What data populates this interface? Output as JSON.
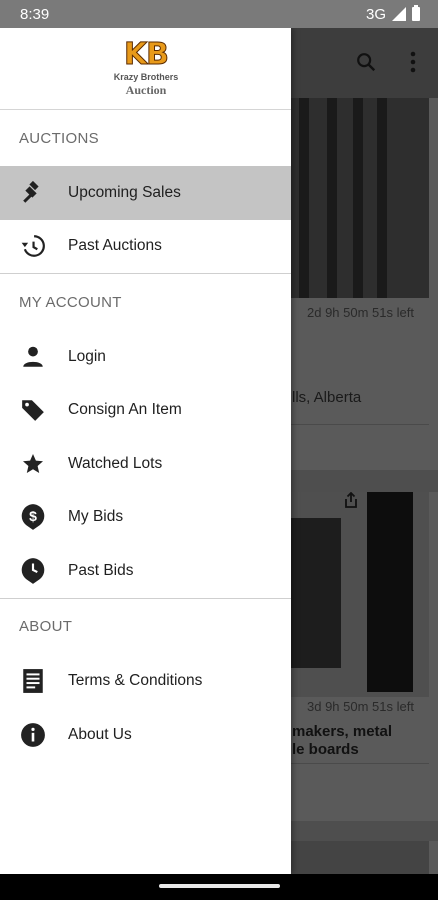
{
  "status_bar": {
    "time": "8:39",
    "network": "3G"
  },
  "brand": {
    "logo_text": "KB",
    "line1": "Krazy Brothers",
    "line2": "Auction"
  },
  "drawer": {
    "sections": [
      {
        "header": "AUCTIONS",
        "items": [
          {
            "label": "Upcoming Sales",
            "icon": "gavel-icon",
            "active": true
          },
          {
            "label": "Past Auctions",
            "icon": "history-icon",
            "active": false
          }
        ]
      },
      {
        "header": "MY ACCOUNT",
        "items": [
          {
            "label": "Login",
            "icon": "person-icon"
          },
          {
            "label": "Consign An Item",
            "icon": "tag-icon"
          },
          {
            "label": "Watched Lots",
            "icon": "star-icon"
          },
          {
            "label": "My Bids",
            "icon": "dollar-pin-icon"
          },
          {
            "label": "Past Bids",
            "icon": "clock-pin-icon"
          }
        ]
      },
      {
        "header": "ABOUT",
        "items": [
          {
            "label": "Terms & Conditions",
            "icon": "document-icon"
          },
          {
            "label": "About Us",
            "icon": "info-icon"
          }
        ]
      }
    ]
  },
  "background": {
    "toolbar": {
      "search_icon": "search-icon",
      "menu_icon": "more-vert-icon"
    },
    "card1": {
      "timer": "2d 9h 50m 51s left",
      "location": "lls, Alberta"
    },
    "card2": {
      "timer": "3d 9h 50m 51s left",
      "title_line1": "makers, metal",
      "title_line2": "le boards"
    }
  },
  "colors": {
    "active_item_bg": "#c4c4c4",
    "scrim": "#5a5a5a",
    "logo_orange": "#e89a1a"
  }
}
